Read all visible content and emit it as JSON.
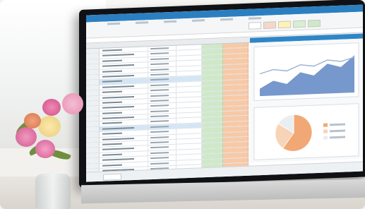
{
  "scene": {
    "description_free": true,
    "colors": {
      "excel_blue": "#2b7fc1",
      "green_column": "#cfe8c9",
      "orange_column": "#f8c9a6",
      "area_chart": "#5f86c4",
      "pie_primary": "#f2a874"
    }
  },
  "spreadsheet": {
    "row_count": 24
  },
  "chart_data": [
    {
      "type": "area",
      "title": "",
      "xlabel": "",
      "ylabel": "",
      "series": [
        {
          "values": [
            2,
            4,
            3,
            6,
            5,
            8,
            7,
            10
          ]
        },
        {
          "values": [
            6,
            7,
            6.5,
            8,
            7.5,
            9,
            8.5,
            9.5
          ]
        }
      ]
    },
    {
      "type": "pie",
      "title": "",
      "values": [
        60,
        24,
        16
      ]
    }
  ]
}
